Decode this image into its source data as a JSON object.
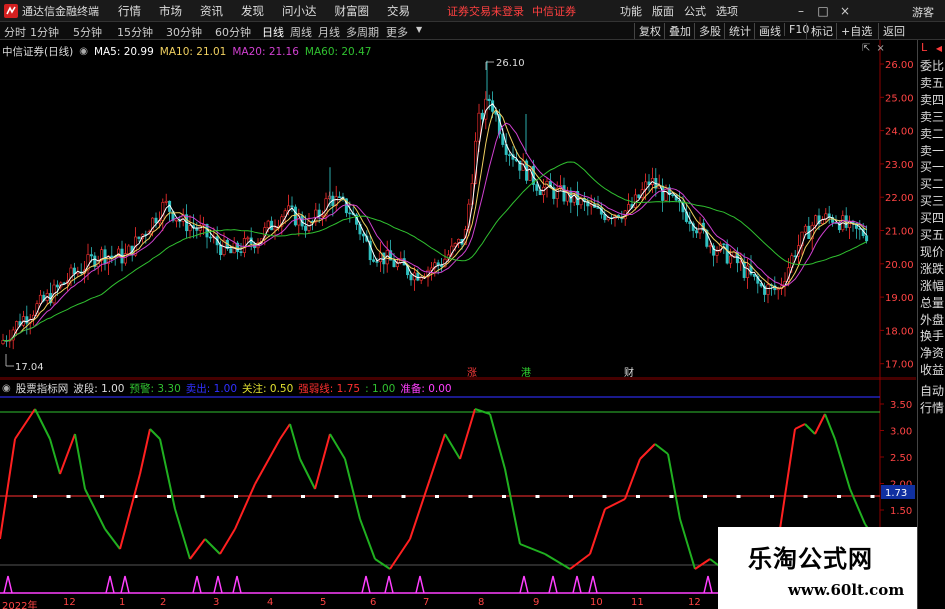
{
  "titlebar": {
    "app_title": "通达信金融终端",
    "menu": [
      "行情",
      "市场",
      "资讯",
      "发现",
      "问小达",
      "财富圈",
      "交易"
    ],
    "login_status": "证券交易未登录",
    "broker": "中信证券",
    "right_items": [
      "功能",
      "版面",
      "公式",
      "选项"
    ],
    "guest": "游客"
  },
  "periodbar": {
    "periods": [
      "分时",
      "1分钟",
      "5分钟",
      "15分钟",
      "30分钟",
      "60分钟",
      "日线",
      "周线",
      "月线",
      "多周期",
      "更多"
    ],
    "active": "日线",
    "right_items": [
      "复权",
      "叠加",
      "多股",
      "统计",
      "画线",
      "F10",
      "标记",
      "+自选",
      "返回"
    ]
  },
  "main_legend": {
    "stock": "中信证券(日线)",
    "ma5": "MA5: 20.99",
    "ma10": "MA10: 21.01",
    "ma20": "MA20: 21.16",
    "ma60": "MA60: 20.47"
  },
  "main_chart": {
    "y_ticks": [
      "26.00",
      "25.00",
      "24.00",
      "23.00",
      "22.00",
      "21.00",
      "20.00",
      "19.00",
      "18.00",
      "17.00"
    ],
    "high_label": "26.10",
    "low_label": "17.04",
    "event_markers": [
      "涨",
      "港",
      "财"
    ],
    "colors": {
      "ma5": "#ffffff",
      "ma10": "#f0d060",
      "ma20": "#d040d0",
      "ma60": "#30c030",
      "up": "#ff3030",
      "down": "#30c0c0"
    }
  },
  "ind_legend": {
    "name": "股票指标网",
    "bodong": "波段: 1.00",
    "yujing": "预警: 3.30",
    "blue_item": "卖出: 1.00",
    "guanzhu": "关注: 0.50",
    "qiangruo": "强弱线: 1.75",
    "colon_item": ": 1.00",
    "zhunbei": "准备: 0.00"
  },
  "ind_chart": {
    "y_ticks": [
      "3.50",
      "3.00",
      "2.50",
      "2.00",
      "1.50"
    ],
    "current_tag": "1.73"
  },
  "date_axis": [
    "2022年",
    "12",
    "1",
    "2",
    "3",
    "4",
    "5",
    "6",
    "7",
    "8",
    "9",
    "10",
    "11",
    "12"
  ],
  "sidepanel": {
    "header": "L",
    "items": [
      "委比",
      "卖五",
      "卖四",
      "卖三",
      "卖二",
      "卖一",
      "买一",
      "买二",
      "买三",
      "买四",
      "买五",
      "现价",
      "涨跌",
      "涨幅",
      "总量",
      "外盘",
      "换手",
      "净资",
      "收益",
      "自动",
      "行情"
    ]
  },
  "watermark": {
    "title": "乐淘公式网",
    "url": "www.60lt.com"
  }
}
